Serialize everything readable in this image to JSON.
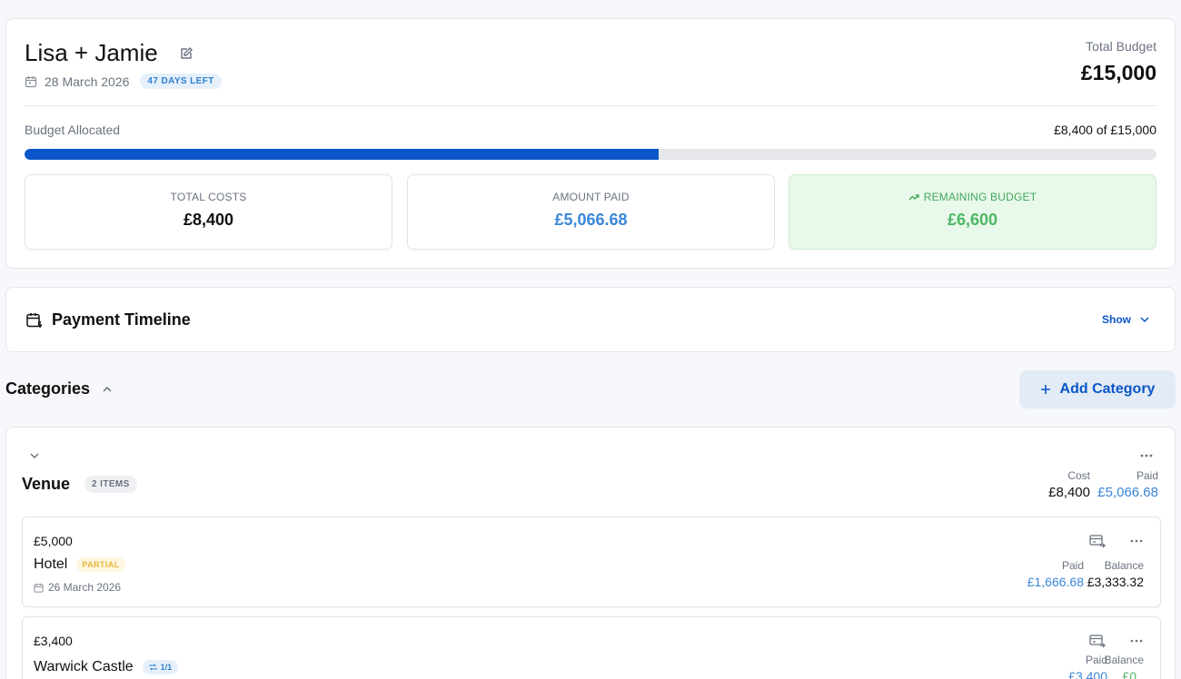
{
  "summary": {
    "couple": "Lisa + Jamie",
    "date": "28 March 2026",
    "days_left": "47 DAYS LEFT",
    "total_budget_label": "Total Budget",
    "total_budget": "£15,000",
    "allocated_label": "Budget Allocated",
    "allocated_value": "£8,400 of £15,000",
    "allocated_fraction": 0.56,
    "stats": {
      "total_costs_label": "TOTAL COSTS",
      "total_costs": "£8,400",
      "amount_paid_label": "AMOUNT PAID",
      "amount_paid": "£5,066.68",
      "remaining_label": "REMAINING BUDGET",
      "remaining": "£6,600"
    }
  },
  "timeline": {
    "title": "Payment Timeline",
    "toggle": "Show"
  },
  "categories": {
    "title": "Categories",
    "add_label": "Add Category"
  },
  "venue": {
    "title": "Venue",
    "items_badge": "2 ITEMS",
    "cost_label": "Cost",
    "paid_label": "Paid",
    "cost": "£8,400",
    "paid": "£5,066.68",
    "items": [
      {
        "price": "£5,000",
        "name": "Hotel",
        "status": "PARTIAL",
        "date": "26 March 2026",
        "paid_label": "Paid",
        "balance_label": "Balance",
        "paid": "£1,666.68",
        "balance": "£3,333.32"
      },
      {
        "price": "£3,400",
        "name": "Warwick Castle",
        "installments": "1/1",
        "paid_label": "Paid",
        "balance_label": "Balance",
        "paid": "£3,400",
        "balance": "£0"
      }
    ]
  },
  "colors": {
    "accent": "#0a56c8",
    "paid_blue": "#3a86d9",
    "remaining_green": "#4cb764"
  }
}
